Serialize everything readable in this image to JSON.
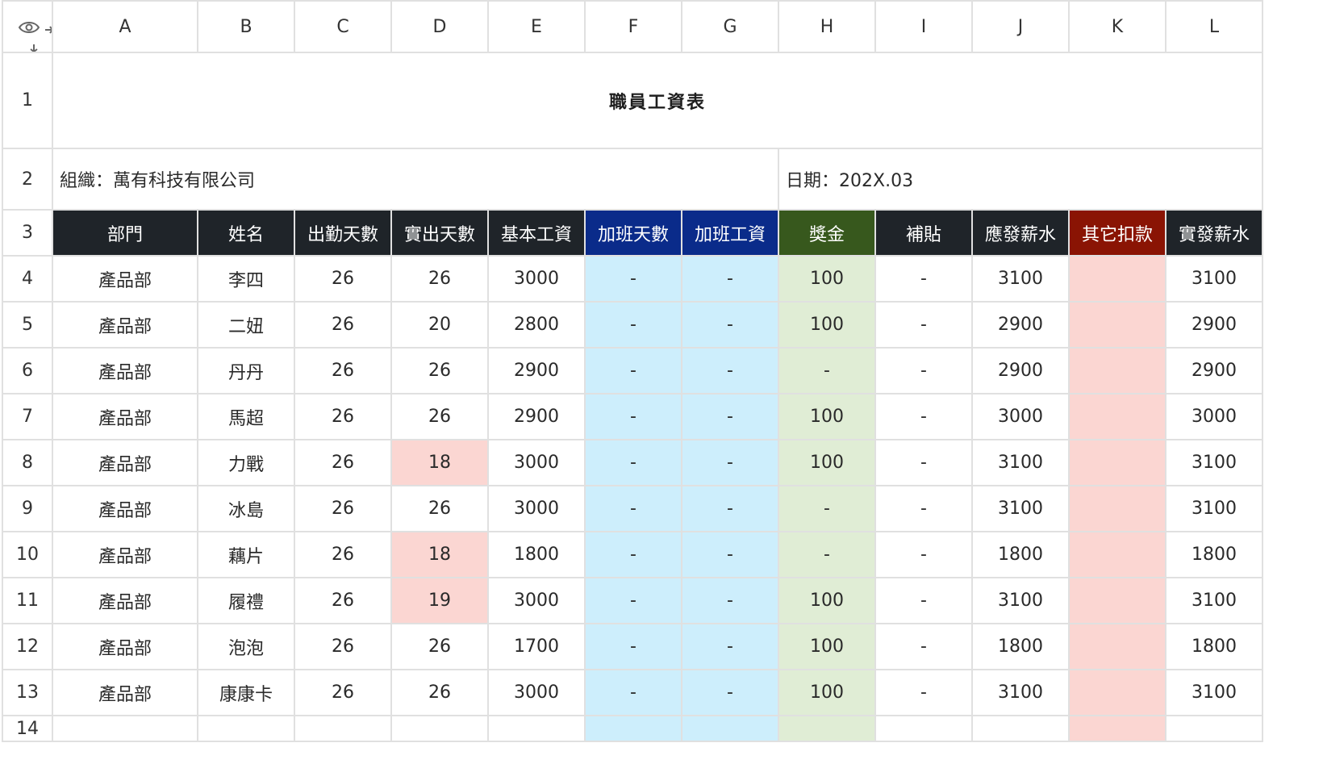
{
  "column_headers": [
    "A",
    "B",
    "C",
    "D",
    "E",
    "F",
    "G",
    "H",
    "I",
    "J",
    "K",
    "L"
  ],
  "title": "職員工資表",
  "org_label": "組織：",
  "org_name": "萬有科技有限公司",
  "date_label": "日期：",
  "date_value": "202X.03",
  "table_headers": [
    "部門",
    "姓名",
    "出勤天數",
    "實出天數",
    "基本工資",
    "加班天數",
    "加班工資",
    "獎金",
    "補貼",
    "應發薪水",
    "其它扣款",
    "實發薪水"
  ],
  "rows": [
    {
      "num": "4",
      "cells": [
        "產品部",
        "李四",
        "26",
        "26",
        "3000",
        "-",
        "-",
        "100",
        "-",
        "3100",
        "",
        "3100"
      ]
    },
    {
      "num": "5",
      "cells": [
        "產品部",
        "二妞",
        "26",
        "20",
        "2800",
        "-",
        "-",
        "100",
        "-",
        "2900",
        "",
        "2900"
      ]
    },
    {
      "num": "6",
      "cells": [
        "產品部",
        "丹丹",
        "26",
        "26",
        "2900",
        "-",
        "-",
        "-",
        "-",
        "2900",
        "",
        "2900"
      ]
    },
    {
      "num": "7",
      "cells": [
        "產品部",
        "馬超",
        "26",
        "26",
        "2900",
        "-",
        "-",
        "100",
        "-",
        "3000",
        "",
        "3000"
      ]
    },
    {
      "num": "8",
      "cells": [
        "產品部",
        "力戰",
        "26",
        "18",
        "3000",
        "-",
        "-",
        "100",
        "-",
        "3100",
        "",
        "3100"
      ]
    },
    {
      "num": "9",
      "cells": [
        "產品部",
        "冰島",
        "26",
        "26",
        "3000",
        "-",
        "-",
        "-",
        "-",
        "3100",
        "",
        "3100"
      ]
    },
    {
      "num": "10",
      "cells": [
        "產品部",
        "藕片",
        "26",
        "18",
        "1800",
        "-",
        "-",
        "-",
        "-",
        "1800",
        "",
        "1800"
      ]
    },
    {
      "num": "11",
      "cells": [
        "產品部",
        "履禮",
        "26",
        "19",
        "3000",
        "-",
        "-",
        "100",
        "-",
        "3100",
        "",
        "3100"
      ]
    },
    {
      "num": "12",
      "cells": [
        "產品部",
        "泡泡",
        "26",
        "26",
        "1700",
        "-",
        "-",
        "100",
        "-",
        "1800",
        "",
        "1800"
      ]
    },
    {
      "num": "13",
      "cells": [
        "產品部",
        "康康卡",
        "26",
        "26",
        "3000",
        "-",
        "-",
        "100",
        "-",
        "3100",
        "",
        "3100"
      ]
    }
  ],
  "row_numbers_top": [
    "1",
    "2",
    "3"
  ],
  "row_number_partial": "14",
  "icons": {
    "visibility": "eye-icon",
    "column_resize": "column-resize-icon",
    "row_resize": "row-resize-icon"
  },
  "colors": {
    "header_dark": "#1f2429",
    "header_blue": "#0a2b8a",
    "header_green": "#37581d",
    "header_red": "#8a1404",
    "overtime_fill": "#cdeefc",
    "bonus_fill": "#e0edd5",
    "deduction_fill": "#fbd6d2"
  }
}
